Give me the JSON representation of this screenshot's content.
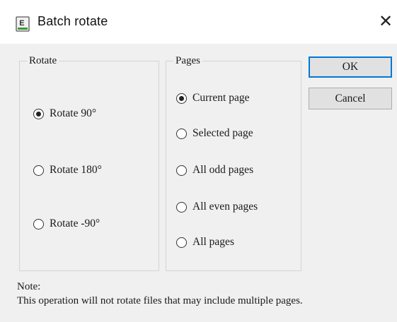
{
  "window": {
    "title": "Batch rotate",
    "close_glyph": "✕",
    "icon": "app-document-icon"
  },
  "rotate_group": {
    "label": "Rotate",
    "options": [
      {
        "label": "Rotate 90°",
        "selected": true
      },
      {
        "label": "Rotate 180°",
        "selected": false
      },
      {
        "label": "Rotate -90°",
        "selected": false
      }
    ]
  },
  "pages_group": {
    "label": "Pages",
    "options": [
      {
        "label": "Current page",
        "selected": true
      },
      {
        "label": "Selected page",
        "selected": false
      },
      {
        "label": "All odd pages",
        "selected": false
      },
      {
        "label": "All even pages",
        "selected": false
      },
      {
        "label": "All pages",
        "selected": false
      }
    ]
  },
  "buttons": {
    "ok": "OK",
    "cancel": "Cancel"
  },
  "note": {
    "heading": "Note:",
    "text": "This operation will not rotate files that may include multiple pages."
  },
  "colors": {
    "accent": "#0078d7",
    "dialog_bg": "#f0f0f0",
    "button_bg": "#e1e1e1"
  }
}
